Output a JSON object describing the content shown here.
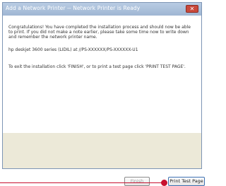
{
  "window": {
    "title": "Add a Network Printer -- Network Printer is Ready"
  },
  "content": {
    "paragraph1": "Congratulations! You have completed the installation process and should now be able to print. If you did not make a note earlier, please take some time now to write down and remember the network printer name.",
    "printer_name": "hp deskjet 3600 series (LIDIL) at //PS-XXXXXX/PS-XXXXXX-U1",
    "paragraph3": "To exit the installation click 'FINISH', or to print a test page click 'PRINT TEST PAGE'."
  },
  "buttons": {
    "finish_label": "Finish",
    "print_label": "Print Test Page"
  },
  "colors": {
    "callout": "#c8102e",
    "titlebar": "#a9bfdb"
  },
  "icons": {
    "close": "close-icon"
  }
}
